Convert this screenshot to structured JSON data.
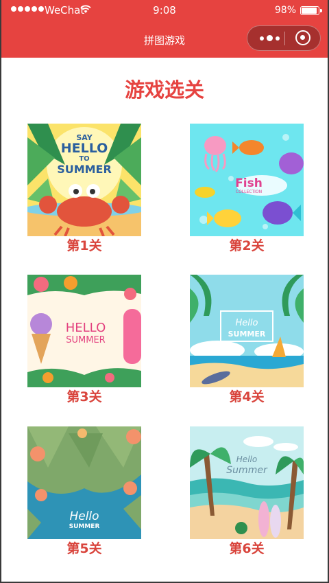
{
  "status_bar": {
    "carrier": "WeChat",
    "time": "9:08",
    "battery_percent": "98%",
    "battery_level": 0.98
  },
  "nav": {
    "title": "拼图游戏"
  },
  "page": {
    "heading": "游戏选关"
  },
  "levels": [
    {
      "label": "第1关",
      "art_text": [
        "SAY",
        "HELLO",
        "TO",
        "SUMMER"
      ]
    },
    {
      "label": "第2关",
      "art_text": [
        "Fish",
        "COLLECTION"
      ]
    },
    {
      "label": "第3关",
      "art_text": [
        "HELLO",
        "SUMMER"
      ]
    },
    {
      "label": "第4关",
      "art_text": [
        "Hello",
        "SUMMER"
      ]
    },
    {
      "label": "第5关",
      "art_text": [
        "Hello",
        "SUMMER"
      ]
    },
    {
      "label": "第6关",
      "art_text": [
        "Hello",
        "Summer"
      ]
    }
  ],
  "colors": {
    "brand_red": "#e64340",
    "label_red": "#d9453d"
  }
}
